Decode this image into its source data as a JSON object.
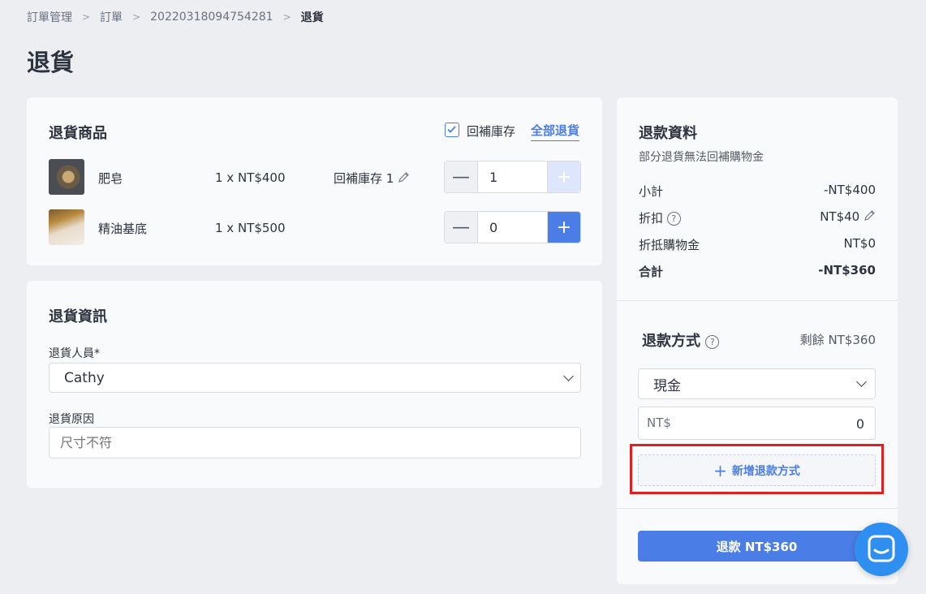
{
  "breadcrumb": {
    "item1": "訂單管理",
    "item2": "訂單",
    "item3": "20220318094754281",
    "current": "退貨"
  },
  "page_title": "退貨",
  "items_card": {
    "title": "退貨商品",
    "restock_label": "回補庫存",
    "restock_checked": true,
    "return_all": "全部退貨",
    "items": [
      {
        "name": "肥皂",
        "price": "1 x NT$400",
        "restock": "回補庫存 1",
        "qty": "1",
        "minus": "—",
        "plus": "+"
      },
      {
        "name": "精油基底",
        "price": "1 x NT$500",
        "qty": "0",
        "minus": "—",
        "plus": "+"
      }
    ]
  },
  "info_card": {
    "title": "退貨資訊",
    "staff_label": "退貨人員*",
    "staff_value": "Cathy",
    "reason_label": "退貨原因",
    "reason_placeholder": "尺寸不符"
  },
  "refund_card": {
    "title": "退款資料",
    "subtitle": "部分退貨無法回補購物金",
    "rows": [
      {
        "label": "小計",
        "value": "-NT$400"
      },
      {
        "label": "折扣",
        "value": "NT$40"
      },
      {
        "label": "折抵購物金",
        "value": "NT$0"
      },
      {
        "label": "合計",
        "value": "-NT$360"
      }
    ],
    "method_title": "退款方式",
    "remaining": "剩餘 NT$360",
    "method_value": "現金",
    "amount_prefix": "NT$",
    "amount_value": "0",
    "add_method": "新增退款方式",
    "add_icon": "+",
    "submit": "退款 NT$360"
  },
  "colors": {
    "accent": "#4a7de6",
    "highlight": "#e02020",
    "chat": "#2f8ff0"
  }
}
